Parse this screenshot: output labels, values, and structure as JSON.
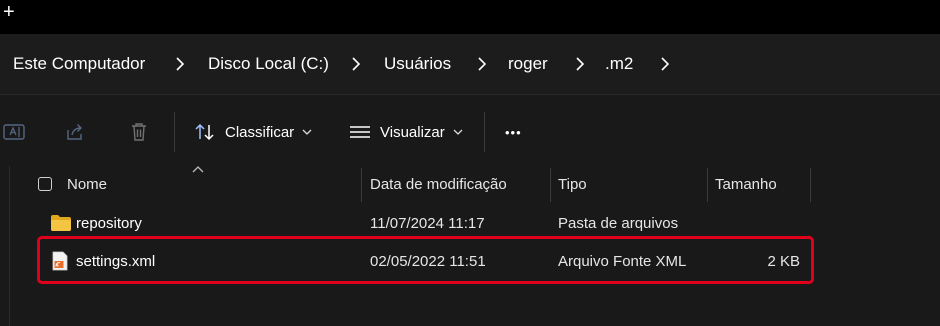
{
  "tabstrip": {
    "new_tab_symbol": "+"
  },
  "breadcrumb": {
    "items": [
      {
        "label": "Este Computador"
      },
      {
        "label": "Disco Local (C:)"
      },
      {
        "label": "Usuários"
      },
      {
        "label": "roger"
      },
      {
        "label": ".m2"
      }
    ]
  },
  "toolbar": {
    "sort_label": "Classificar",
    "view_label": "Visualizar",
    "more_label": "•••"
  },
  "columns": {
    "name": "Nome",
    "modified": "Data de modificação",
    "type": "Tipo",
    "size": "Tamanho"
  },
  "files": [
    {
      "name": "repository",
      "modified": "11/07/2024 11:17",
      "type": "Pasta de arquivos",
      "size": "",
      "icon": "folder-icon"
    },
    {
      "name": "settings.xml",
      "modified": "02/05/2022 11:51",
      "type": "Arquivo Fonte XML",
      "size": "2 KB",
      "icon": "xml-file-icon"
    }
  ],
  "colors": {
    "background": "#191919",
    "highlight": "#e0001b",
    "folder": "#f4c542",
    "xml_icon": "#e8702a"
  }
}
